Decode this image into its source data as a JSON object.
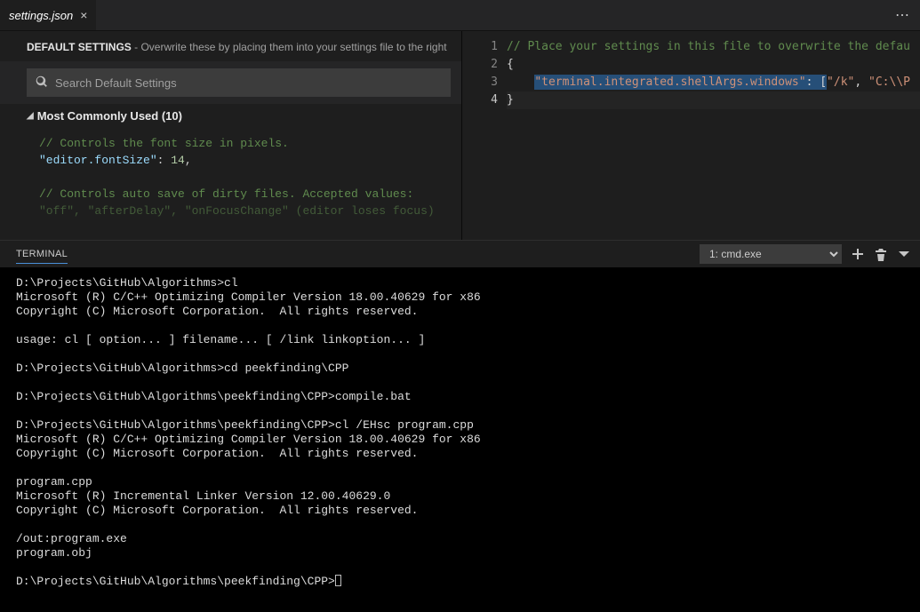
{
  "tab": {
    "title": "settings.json"
  },
  "defaults": {
    "header_strong": "DEFAULT SETTINGS",
    "header_rest": " - Overwrite these by placing them into your settings file to the right",
    "search_placeholder": "Search Default Settings",
    "section": "Most Commonly Used (10)",
    "line1_comment": "// Controls the font size in pixels.",
    "line2_key": "\"editor.fontSize\"",
    "line2_val": "14",
    "line3_comment": "// Controls auto save of dirty files. Accepted values:",
    "line4_comment": "\"off\", \"afterDelay\", \"onFocusChange\" (editor loses focus)"
  },
  "editor": {
    "gutter": [
      "1",
      "2",
      "3",
      "4"
    ],
    "line1_comment": "// Place your settings in this file to overwrite the defau",
    "line2_open": "{",
    "line3_indent": "    ",
    "line3_key": "\"terminal.integrated.shellArgs.windows\"",
    "line3_sep": ": [",
    "line3_arg1": "\"/k\"",
    "line3_comma": ", ",
    "line3_arg2": "\"C:\\\\P",
    "line4_close": "}"
  },
  "terminal": {
    "title": "TERMINAL",
    "select_value": "1: cmd.exe",
    "output": "D:\\Projects\\GitHub\\Algorithms>cl\nMicrosoft (R) C/C++ Optimizing Compiler Version 18.00.40629 for x86\nCopyright (C) Microsoft Corporation.  All rights reserved.\n\nusage: cl [ option... ] filename... [ /link linkoption... ]\n\nD:\\Projects\\GitHub\\Algorithms>cd peekfinding\\CPP\n\nD:\\Projects\\GitHub\\Algorithms\\peekfinding\\CPP>compile.bat\n\nD:\\Projects\\GitHub\\Algorithms\\peekfinding\\CPP>cl /EHsc program.cpp\nMicrosoft (R) C/C++ Optimizing Compiler Version 18.00.40629 for x86\nCopyright (C) Microsoft Corporation.  All rights reserved.\n\nprogram.cpp\nMicrosoft (R) Incremental Linker Version 12.00.40629.0\nCopyright (C) Microsoft Corporation.  All rights reserved.\n\n/out:program.exe\nprogram.obj\n\nD:\\Projects\\GitHub\\Algorithms\\peekfinding\\CPP>"
  }
}
